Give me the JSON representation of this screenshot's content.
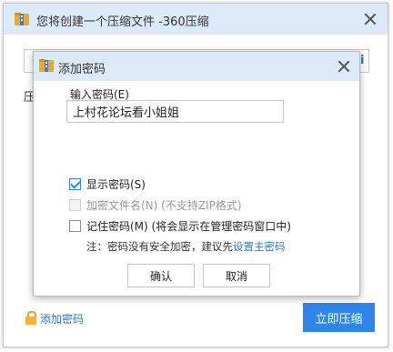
{
  "outer_window": {
    "title": "您将创建一个压缩文件 -360压缩",
    "path_field_partial": "¥",
    "browse_partial": "ii",
    "label_partial": "压",
    "add_password_link": "添加密码",
    "primary_button": "立即压缩"
  },
  "dialog": {
    "title": "添加密码",
    "password_label": "输入密码(E)",
    "password_value": "上村花论坛看小姐姐",
    "options": [
      {
        "label": "显示密码(S)",
        "checked": true,
        "disabled": false
      },
      {
        "label": "加密文件名(N) (不支持ZIP格式)",
        "checked": false,
        "disabled": true
      },
      {
        "label": "记住密码(M) (将会显示在管理密码窗口中)",
        "checked": false,
        "disabled": false
      }
    ],
    "note_text": "注：密码没有安全加密，建议先",
    "note_link": "设置主密码",
    "ok_button": "确认",
    "cancel_button": "取消"
  },
  "colors": {
    "titlebar": "#dbe9f8",
    "accent": "#2d86e8",
    "link": "#2f78d1"
  }
}
